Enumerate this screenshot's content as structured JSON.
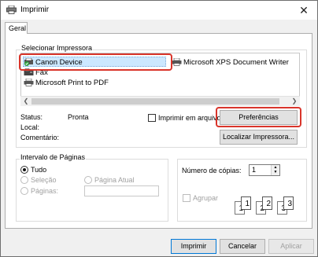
{
  "window": {
    "title": "Imprimir",
    "close_glyph": "✕"
  },
  "tabs": [
    {
      "label": "Geral",
      "selected": true
    }
  ],
  "printer_group": {
    "label": "Selecionar Impressora",
    "printers": [
      {
        "name": "Canon Device",
        "selected": true,
        "icon": "printer-default-icon"
      },
      {
        "name": "Microsoft XPS Document Writer",
        "icon": "printer-icon"
      },
      {
        "name": "Fax",
        "icon": "fax-icon"
      },
      {
        "name": "Microsoft Print to PDF",
        "icon": "printer-icon"
      }
    ],
    "status_label": "Status:",
    "status_value": "Pronta",
    "local_label": "Local:",
    "comment_label": "Comentário:",
    "print_to_file_label": "Imprimir em arquivo",
    "preferences_button": "Preferências",
    "find_printer_button": "Localizar Impressora..."
  },
  "page_range": {
    "label": "Intervalo de Páginas",
    "all_label": "Tudo",
    "selection_label": "Seleção",
    "current_page_label": "Página Atual",
    "pages_label": "Páginas:",
    "selected": "Tudo"
  },
  "copies": {
    "label": "Número de cópias:",
    "value": "1",
    "collate_label": "Agrupar",
    "collate_pages": [
      "1",
      "1",
      "2",
      "2",
      "3",
      "3"
    ]
  },
  "footer": {
    "print_button": "Imprimir",
    "cancel_button": "Cancelar",
    "apply_button": "Aplicar"
  },
  "colors": {
    "highlight": "#d9352b",
    "selection": "#cce8ff",
    "accent": "#0078d7"
  }
}
